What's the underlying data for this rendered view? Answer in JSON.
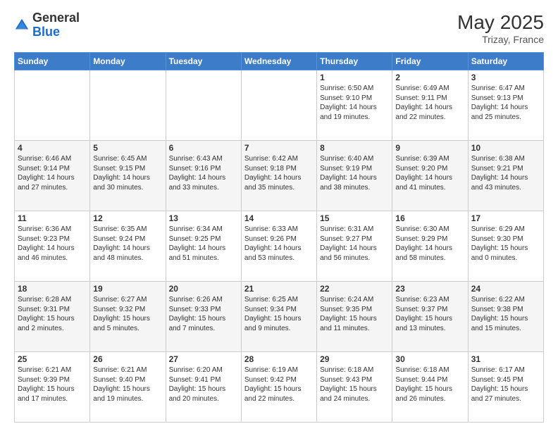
{
  "header": {
    "logo_general": "General",
    "logo_blue": "Blue",
    "month_year": "May 2025",
    "location": "Trizay, France"
  },
  "days_of_week": [
    "Sunday",
    "Monday",
    "Tuesday",
    "Wednesday",
    "Thursday",
    "Friday",
    "Saturday"
  ],
  "weeks": [
    [
      {
        "day": "",
        "info": ""
      },
      {
        "day": "",
        "info": ""
      },
      {
        "day": "",
        "info": ""
      },
      {
        "day": "",
        "info": ""
      },
      {
        "day": "1",
        "info": "Sunrise: 6:50 AM\nSunset: 9:10 PM\nDaylight: 14 hours\nand 19 minutes."
      },
      {
        "day": "2",
        "info": "Sunrise: 6:49 AM\nSunset: 9:11 PM\nDaylight: 14 hours\nand 22 minutes."
      },
      {
        "day": "3",
        "info": "Sunrise: 6:47 AM\nSunset: 9:13 PM\nDaylight: 14 hours\nand 25 minutes."
      }
    ],
    [
      {
        "day": "4",
        "info": "Sunrise: 6:46 AM\nSunset: 9:14 PM\nDaylight: 14 hours\nand 27 minutes."
      },
      {
        "day": "5",
        "info": "Sunrise: 6:45 AM\nSunset: 9:15 PM\nDaylight: 14 hours\nand 30 minutes."
      },
      {
        "day": "6",
        "info": "Sunrise: 6:43 AM\nSunset: 9:16 PM\nDaylight: 14 hours\nand 33 minutes."
      },
      {
        "day": "7",
        "info": "Sunrise: 6:42 AM\nSunset: 9:18 PM\nDaylight: 14 hours\nand 35 minutes."
      },
      {
        "day": "8",
        "info": "Sunrise: 6:40 AM\nSunset: 9:19 PM\nDaylight: 14 hours\nand 38 minutes."
      },
      {
        "day": "9",
        "info": "Sunrise: 6:39 AM\nSunset: 9:20 PM\nDaylight: 14 hours\nand 41 minutes."
      },
      {
        "day": "10",
        "info": "Sunrise: 6:38 AM\nSunset: 9:21 PM\nDaylight: 14 hours\nand 43 minutes."
      }
    ],
    [
      {
        "day": "11",
        "info": "Sunrise: 6:36 AM\nSunset: 9:23 PM\nDaylight: 14 hours\nand 46 minutes."
      },
      {
        "day": "12",
        "info": "Sunrise: 6:35 AM\nSunset: 9:24 PM\nDaylight: 14 hours\nand 48 minutes."
      },
      {
        "day": "13",
        "info": "Sunrise: 6:34 AM\nSunset: 9:25 PM\nDaylight: 14 hours\nand 51 minutes."
      },
      {
        "day": "14",
        "info": "Sunrise: 6:33 AM\nSunset: 9:26 PM\nDaylight: 14 hours\nand 53 minutes."
      },
      {
        "day": "15",
        "info": "Sunrise: 6:31 AM\nSunset: 9:27 PM\nDaylight: 14 hours\nand 56 minutes."
      },
      {
        "day": "16",
        "info": "Sunrise: 6:30 AM\nSunset: 9:29 PM\nDaylight: 14 hours\nand 58 minutes."
      },
      {
        "day": "17",
        "info": "Sunrise: 6:29 AM\nSunset: 9:30 PM\nDaylight: 15 hours\nand 0 minutes."
      }
    ],
    [
      {
        "day": "18",
        "info": "Sunrise: 6:28 AM\nSunset: 9:31 PM\nDaylight: 15 hours\nand 2 minutes."
      },
      {
        "day": "19",
        "info": "Sunrise: 6:27 AM\nSunset: 9:32 PM\nDaylight: 15 hours\nand 5 minutes."
      },
      {
        "day": "20",
        "info": "Sunrise: 6:26 AM\nSunset: 9:33 PM\nDaylight: 15 hours\nand 7 minutes."
      },
      {
        "day": "21",
        "info": "Sunrise: 6:25 AM\nSunset: 9:34 PM\nDaylight: 15 hours\nand 9 minutes."
      },
      {
        "day": "22",
        "info": "Sunrise: 6:24 AM\nSunset: 9:35 PM\nDaylight: 15 hours\nand 11 minutes."
      },
      {
        "day": "23",
        "info": "Sunrise: 6:23 AM\nSunset: 9:37 PM\nDaylight: 15 hours\nand 13 minutes."
      },
      {
        "day": "24",
        "info": "Sunrise: 6:22 AM\nSunset: 9:38 PM\nDaylight: 15 hours\nand 15 minutes."
      }
    ],
    [
      {
        "day": "25",
        "info": "Sunrise: 6:21 AM\nSunset: 9:39 PM\nDaylight: 15 hours\nand 17 minutes."
      },
      {
        "day": "26",
        "info": "Sunrise: 6:21 AM\nSunset: 9:40 PM\nDaylight: 15 hours\nand 19 minutes."
      },
      {
        "day": "27",
        "info": "Sunrise: 6:20 AM\nSunset: 9:41 PM\nDaylight: 15 hours\nand 20 minutes."
      },
      {
        "day": "28",
        "info": "Sunrise: 6:19 AM\nSunset: 9:42 PM\nDaylight: 15 hours\nand 22 minutes."
      },
      {
        "day": "29",
        "info": "Sunrise: 6:18 AM\nSunset: 9:43 PM\nDaylight: 15 hours\nand 24 minutes."
      },
      {
        "day": "30",
        "info": "Sunrise: 6:18 AM\nSunset: 9:44 PM\nDaylight: 15 hours\nand 26 minutes."
      },
      {
        "day": "31",
        "info": "Sunrise: 6:17 AM\nSunset: 9:45 PM\nDaylight: 15 hours\nand 27 minutes."
      }
    ]
  ]
}
